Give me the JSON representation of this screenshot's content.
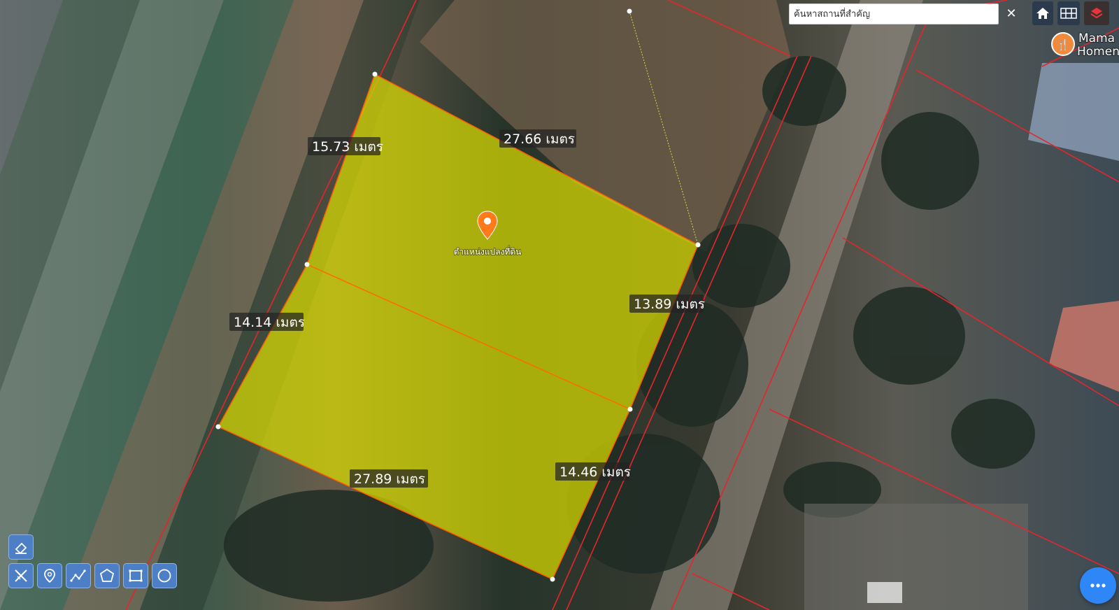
{
  "search": {
    "placeholder": "ค้นหาสถานที่สำคัญ"
  },
  "measurements": {
    "top_left_edge": "15.73 เมตร",
    "top_edge": "27.66 เมตร",
    "right_upper_edge": "13.89 เมตร",
    "left_lower_edge": "14.14 เมตร",
    "bottom_edge": "27.89 เมตร",
    "right_lower_edge": "14.46 เมตร"
  },
  "parcel": {
    "pin_caption": "ตำแหน่งแปลงที่ดิน",
    "fill_color": "#d9dc00",
    "edge_color": "#ff5a00"
  },
  "poi": {
    "name_line1": "Mama",
    "name_line2": "Homen"
  },
  "toolbar": {
    "tools": [
      "eraser-icon",
      "clear-tools-icon",
      "marker-icon",
      "polyline-icon",
      "polygon-icon",
      "rectangle-icon",
      "circle-icon"
    ]
  },
  "colors": {
    "boundary_lines": "#e3262c",
    "tool_button": "#4d7fc7",
    "chat_button": "#2f86f6"
  }
}
